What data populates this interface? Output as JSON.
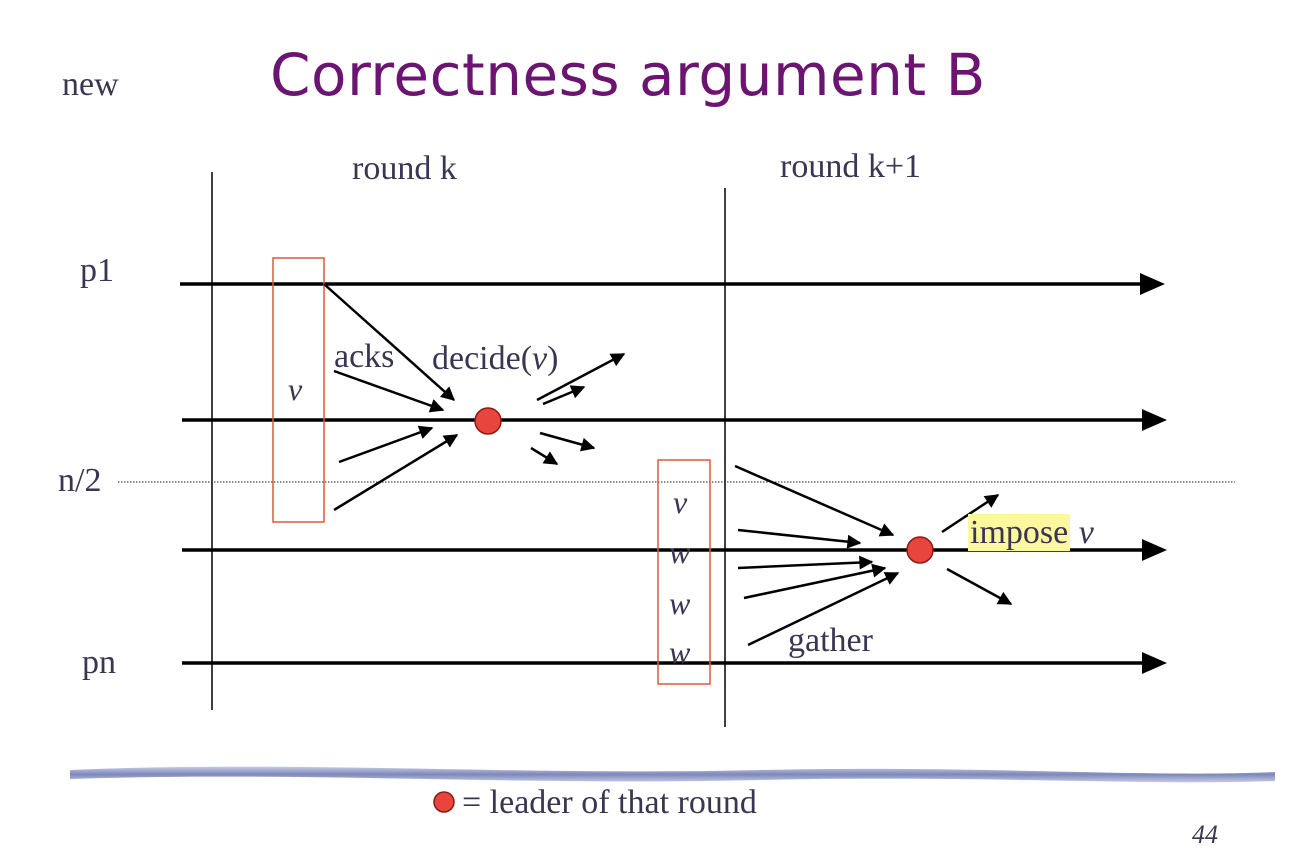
{
  "slide": {
    "tag": "new",
    "title": "Correctness argument B",
    "page_number": "44"
  },
  "diagram": {
    "rounds": [
      "round k",
      "round k+1"
    ],
    "processes": {
      "first": "p1",
      "threshold": "n/2",
      "last": "pn"
    },
    "round_k": {
      "box_values": [
        "v"
      ],
      "acks_label": "acks",
      "decide_label": "decide(",
      "decide_value": "v",
      "decide_close": ")"
    },
    "round_k1": {
      "box_values": [
        "v",
        "w",
        "w",
        "w"
      ],
      "gather_label": "gather",
      "impose_label": "impose",
      "impose_value": "v"
    },
    "legend": {
      "text": "= leader of that round"
    },
    "colors": {
      "title": "#6b1472",
      "text": "#3a3550",
      "leader": "#e8453c",
      "box": "#e2563f",
      "highlight": "#fcf8a0",
      "wave": "#8a94c0"
    }
  }
}
